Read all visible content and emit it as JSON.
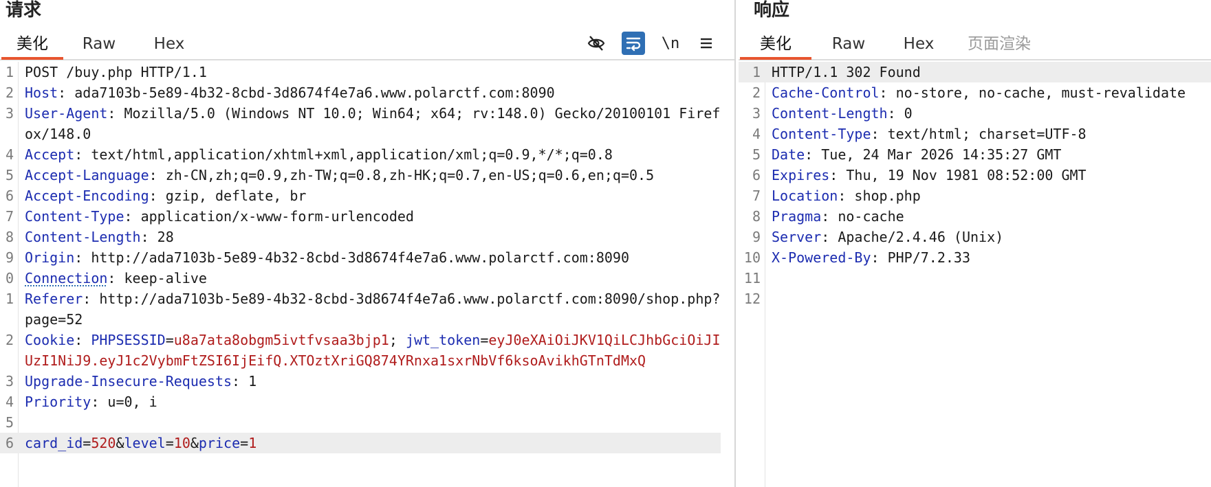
{
  "request": {
    "title": "请求",
    "tabs": [
      {
        "label": "美化",
        "active": true
      },
      {
        "label": "Raw",
        "active": false
      },
      {
        "label": "Hex",
        "active": false
      }
    ],
    "toolbar": {
      "hide_icon": "eye-slash-icon",
      "wrap_icon": "word-wrap-icon",
      "newline_label": "\\n",
      "menu_icon": "hamburger-menu-icon"
    },
    "request_line": "POST /buy.php HTTP/1.1",
    "headers": [
      {
        "n": "2",
        "name": "Host",
        "value": "ada7103b-5e89-4b32-8cbd-3d8674f4e7a6.www.polarctf.com:8090"
      },
      {
        "n": "3",
        "name": "User-Agent",
        "value": "Mozilla/5.0 (Windows NT 10.0; Win64; x64; rv:148.0) Gecko/20100101 Firefox/148.0"
      },
      {
        "n": "4",
        "name": "Accept",
        "value": "text/html,application/xhtml+xml,application/xml;q=0.9,*/*;q=0.8"
      },
      {
        "n": "5",
        "name": "Accept-Language",
        "value": "zh-CN,zh;q=0.9,zh-TW;q=0.8,zh-HK;q=0.7,en-US;q=0.6,en;q=0.5"
      },
      {
        "n": "6",
        "name": "Accept-Encoding",
        "value": "gzip, deflate, br"
      },
      {
        "n": "7",
        "name": "Content-Type",
        "value": "application/x-www-form-urlencoded"
      },
      {
        "n": "8",
        "name": "Content-Length",
        "value": "28"
      },
      {
        "n": "9",
        "name": "Origin",
        "value": "http://ada7103b-5e89-4b32-8cbd-3d8674f4e7a6.www.polarctf.com:8090"
      },
      {
        "n": "0",
        "name": "Connection",
        "value": "keep-alive"
      },
      {
        "n": "1",
        "name": "Referer",
        "value": "http://ada7103b-5e89-4b32-8cbd-3d8674f4e7a6.www.polarctf.com:8090/shop.php?page=52"
      }
    ],
    "cookie": {
      "n": "2",
      "name": "Cookie",
      "k1": "PHPSESSID",
      "v1": "u8a7ata8obgm5ivtfvsaa3bjp1",
      "k2": "jwt_token",
      "v2": "eyJ0eXAiOiJKV1QiLCJhbGciOiJIUzI1NiJ9.eyJ1c2VybmFtZSI6IjEifQ.XTOztXriGQ874YRnxa1sxrNbVf6ksoAvikhGTnTdMxQ"
    },
    "headers2": [
      {
        "n": "3",
        "name": "Upgrade-Insecure-Requests",
        "value": "1"
      },
      {
        "n": "4",
        "name": "Priority",
        "value": "u=0, i"
      }
    ],
    "blank_n": "5",
    "body": {
      "n": "6",
      "k1": "card_id",
      "v1": "520",
      "k2": "level",
      "v2": "10",
      "k3": "price",
      "v3": "1"
    }
  },
  "response": {
    "title": "响应",
    "tabs": [
      {
        "label": "美化",
        "active": true
      },
      {
        "label": "Raw",
        "active": false
      },
      {
        "label": "Hex",
        "active": false
      },
      {
        "label": "页面渲染",
        "active": false
      }
    ],
    "status_line": "HTTP/1.1 302 Found",
    "headers": [
      {
        "n": "2",
        "name": "Cache-Control",
        "value": "no-store, no-cache, must-revalidate"
      },
      {
        "n": "3",
        "name": "Content-Length",
        "value": "0"
      },
      {
        "n": "4",
        "name": "Content-Type",
        "value": "text/html; charset=UTF-8"
      },
      {
        "n": "5",
        "name": "Date",
        "value": "Tue, 24 Mar 2026 14:35:27 GMT"
      },
      {
        "n": "6",
        "name": "Expires",
        "value": "Thu, 19 Nov 1981 08:52:00 GMT"
      },
      {
        "n": "7",
        "name": "Location",
        "value": "shop.php"
      },
      {
        "n": "8",
        "name": "Pragma",
        "value": "no-cache"
      },
      {
        "n": "9",
        "name": "Server",
        "value": "Apache/2.4.46 (Unix)"
      },
      {
        "n": "10",
        "name": "X-Powered-By",
        "value": "PHP/7.2.33"
      }
    ],
    "trailing_line_numbers": [
      "11",
      "12"
    ]
  },
  "colors": {
    "header_name": "#1c2cb0",
    "param_value": "#b01c1c",
    "tab_accent": "#e8552f",
    "toolbar_active": "#2f6fb4"
  }
}
